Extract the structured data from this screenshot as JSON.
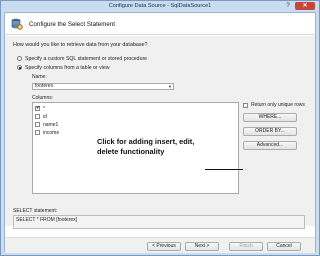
{
  "window": {
    "title": "Configure Data Source - SqlDataSource1"
  },
  "header": {
    "title": "Configure the Select Statement"
  },
  "question": "How would you like to retrieve data from your database?",
  "options": [
    {
      "label": "Specify a custom SQL statement or stored procedure",
      "selected": false
    },
    {
      "label": "Specify columns from a table or view",
      "selected": true
    }
  ],
  "name_field": {
    "label": "Name:",
    "value": "footerex"
  },
  "columns": {
    "label": "Columns:",
    "items": [
      {
        "label": "*",
        "checked": true
      },
      {
        "label": "id",
        "checked": false
      },
      {
        "label": "name1",
        "checked": false
      },
      {
        "label": "income",
        "checked": false
      }
    ]
  },
  "return_unique": {
    "label": "Return only unique rows",
    "checked": false
  },
  "buttons": {
    "where": "WHERE...",
    "order_by": "ORDER BY...",
    "advanced": "Advanced..."
  },
  "annotation": {
    "text": "Click for adding insert, edit, delete functionality"
  },
  "statement": {
    "label": "SELECT statement:",
    "value": "SELECT * FROM [footerex]"
  },
  "footer": {
    "previous": "< Previous",
    "next": "Next >",
    "finish": "Finish",
    "cancel": "Cancel"
  },
  "icons": {
    "help": "help-icon",
    "close": "close-icon",
    "wizard": "database-gear-icon",
    "dropdown": "chevron-down-icon"
  },
  "colors": {
    "title_bar": "#c9dcf0",
    "close_button": "#c7463a"
  }
}
